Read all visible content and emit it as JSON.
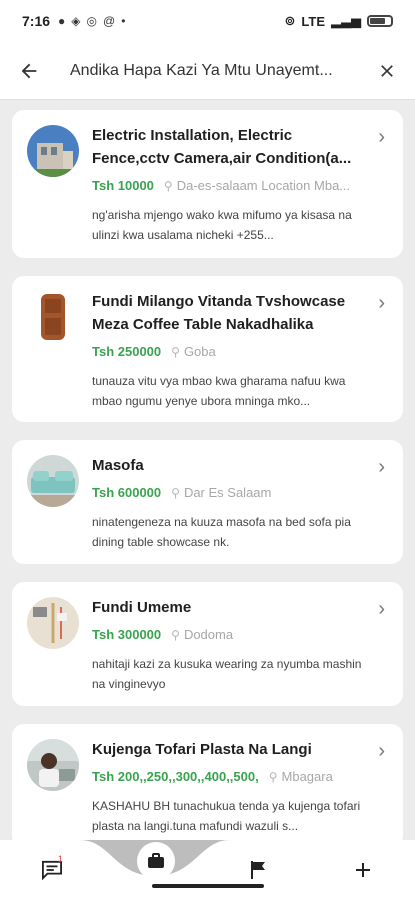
{
  "status": {
    "time": "7:16",
    "network": "LTE"
  },
  "header": {
    "title": "Andika Hapa Kazi Ya Mtu Unayemt..."
  },
  "listings": [
    {
      "title": "Electric Installation, Electric Fence,cctv Camera,air Condition(a...",
      "price": "Tsh 10000",
      "location": "Da-es-salaam Location Mba...",
      "description": "ng'arisha mjengo wako kwa mifumo ya kisasa na ulinzi kwa usalama nicheki +255..."
    },
    {
      "title": "Fundi Milango Vitanda Tvshowcase Meza Coffee Table Nakadhalika",
      "price": "Tsh 250000",
      "location": "Goba",
      "description": "tunauza vitu vya mbao kwa gharama nafuu kwa mbao ngumu yenye ubora mninga mko..."
    },
    {
      "title": "Masofa",
      "price": "Tsh 600000",
      "location": "Dar Es Salaam",
      "description": "ninatengeneza na kuuza masofa na bed sofa pia dining table showcase nk."
    },
    {
      "title": "Fundi Umeme",
      "price": "Tsh 300000",
      "location": "Dodoma",
      "description": "nahitaji kazi  za kusuka wearing za nyumba mashin na vinginevyo"
    },
    {
      "title": "Kujenga Tofari Plasta Na Langi",
      "price": "Tsh 200,,250,,300,,400,,500,",
      "location": "Mbagara",
      "description": "KASHAHU BH tunachukua tenda ya kujenga tofari plasta na langi.tuna mafundi wazuli s..."
    }
  ],
  "bottom_nav": {
    "messages_badge": "1"
  }
}
